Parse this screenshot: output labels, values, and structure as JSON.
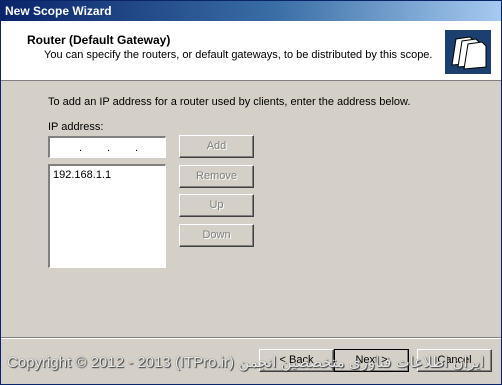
{
  "window": {
    "title": "New Scope Wizard"
  },
  "header": {
    "title": "Router (Default Gateway)",
    "subtitle": "You can specify the routers, or default gateways, to be distributed by this scope.",
    "icon": "folders-icon"
  },
  "main": {
    "instruction": "To add an IP address for a router used by clients, enter the address below.",
    "ip_label": "IP address:",
    "ip_input_value": "",
    "ip_list": [
      "192.168.1.1"
    ],
    "buttons": {
      "add": "Add",
      "remove": "Remove",
      "up": "Up",
      "down": "Down"
    }
  },
  "footer": {
    "back": "< Back",
    "next": "Next >",
    "cancel": "Cancel"
  },
  "watermark": "Copyright © 2012 - 2013 (ITPro.ir) ایران اطلاعات فناوری متخصصین انجمن"
}
